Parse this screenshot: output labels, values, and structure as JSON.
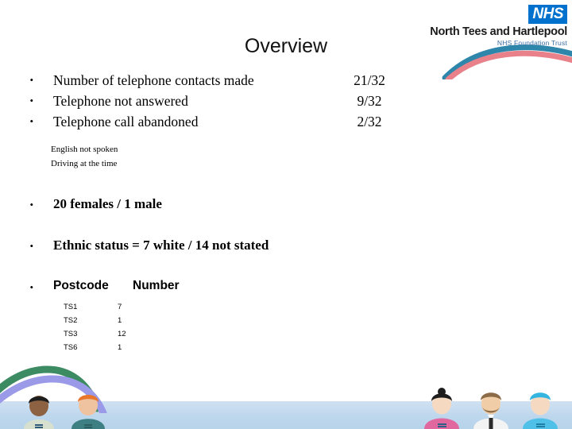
{
  "slide": {
    "title": "Overview",
    "background_color": "#ffffff",
    "band_color": "#bcd6ec"
  },
  "logo": {
    "mark": "NHS",
    "trust_name": "North Tees and Hartlepool",
    "trust_sub": "NHS Foundation Trust",
    "nhs_blue": "#0072ce",
    "arc_teal": "#2e86ab",
    "arc_pink": "#e8818a"
  },
  "stats": {
    "rows": [
      {
        "label": "Number of telephone contacts made",
        "value": "21/32"
      },
      {
        "label": "Telephone not answered",
        "value": "9/32"
      },
      {
        "label": "Telephone call abandoned",
        "value": "2/32"
      }
    ],
    "notes": [
      "English not spoken",
      "Driving at the time"
    ]
  },
  "facts": [
    "20 females / 1 male",
    "Ethnic status = 7 white / 14 not stated"
  ],
  "postcode_table": {
    "headers": {
      "col1": "Postcode",
      "col2": "Number"
    },
    "rows": [
      {
        "postcode": "TS1",
        "number": "7"
      },
      {
        "postcode": "TS2",
        "number": "1"
      },
      {
        "postcode": "TS3",
        "number": "12"
      },
      {
        "postcode": "TS6",
        "number": "1"
      }
    ]
  },
  "decoration": {
    "bullet_glyph": "•",
    "swoosh_green": "#3d8b63",
    "swoosh_purple": "#9a9ae8"
  }
}
